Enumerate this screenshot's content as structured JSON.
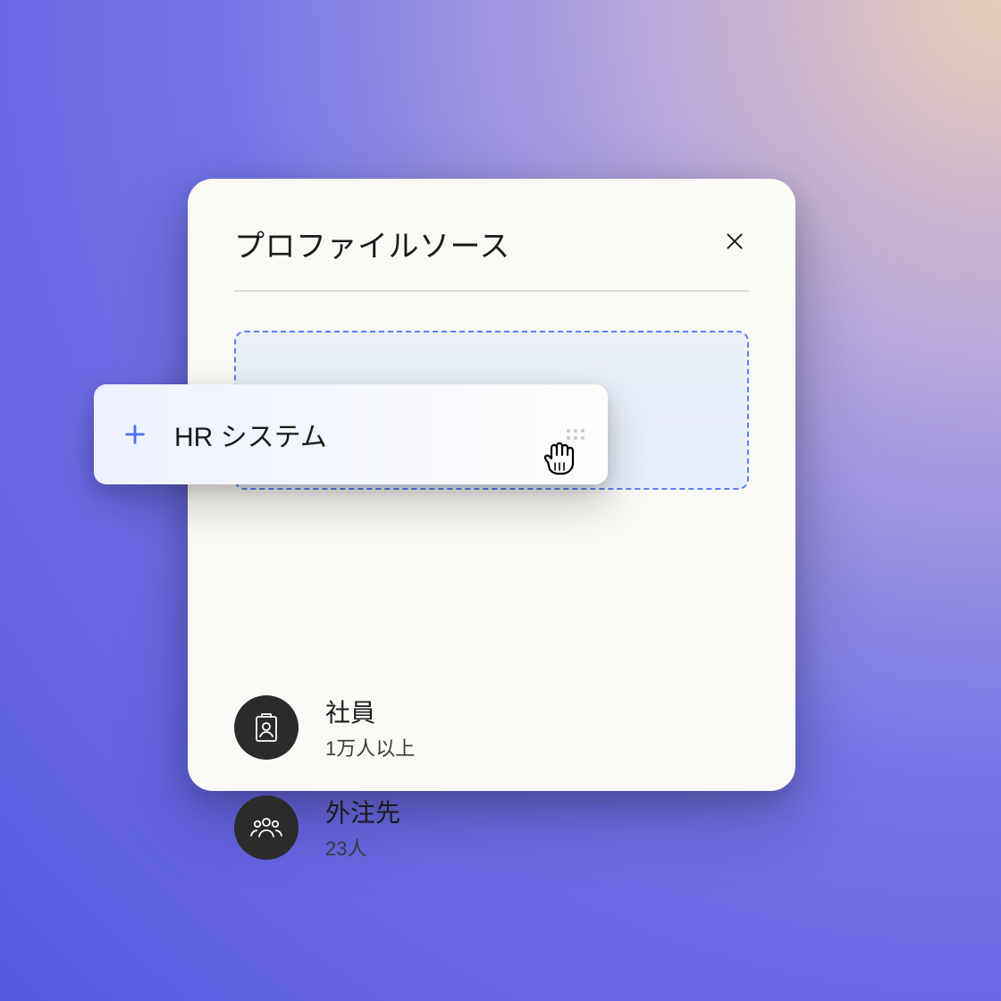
{
  "card": {
    "title": "プロファイルソース",
    "drag_item_label": "HR システム",
    "items": [
      {
        "title": "社員",
        "subtitle": "1万人以上"
      },
      {
        "title": "外注先",
        "subtitle": "23人"
      }
    ]
  },
  "colors": {
    "accent": "#5b7ff5",
    "card_bg": "#fbf9f5",
    "icon_bg": "#2b2b2b"
  }
}
